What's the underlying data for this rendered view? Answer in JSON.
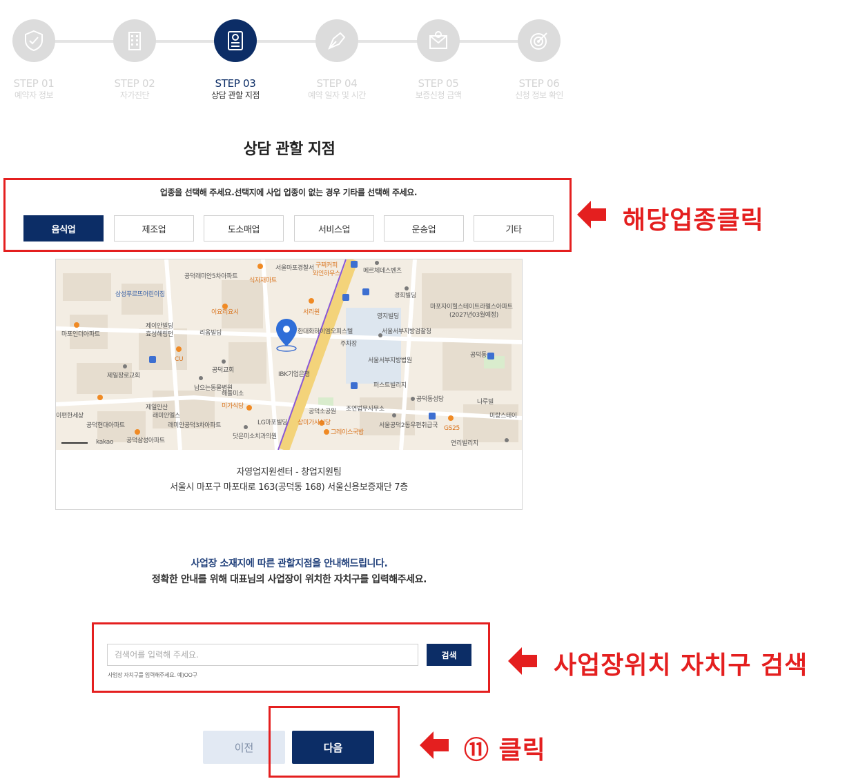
{
  "stepper": {
    "steps": [
      {
        "num": "STEP 01",
        "name": "예약자 정보",
        "icon": "shield-check-icon",
        "active": false
      },
      {
        "num": "STEP 02",
        "name": "자가진단",
        "icon": "building-icon",
        "active": false
      },
      {
        "num": "STEP 03",
        "name": "상담 관할 지점",
        "icon": "document-badge-icon",
        "active": true
      },
      {
        "num": "STEP 04",
        "name": "예약 일자 및 시간",
        "icon": "pen-nib-icon",
        "active": false
      },
      {
        "num": "STEP 05",
        "name": "보증신청 금액",
        "icon": "mail-icon",
        "active": false
      },
      {
        "num": "STEP 06",
        "name": "신청 정보 확인",
        "icon": "target-icon",
        "active": false
      }
    ]
  },
  "page_title": "상담 관할 지점",
  "industry": {
    "guide": "업종을 선택해 주세요.선택지에 사업 업종이 없는 경우 기타를 선택해 주세요.",
    "options": [
      "음식업",
      "제조업",
      "도소매업",
      "서비스업",
      "운송업",
      "기타"
    ],
    "selected": "음식업"
  },
  "map": {
    "labels": [
      "서울마포경찰서",
      "구찌커피",
      "와인하우스",
      "메르체데스벤츠",
      "공덕래미안5차아파트",
      "식자재마트",
      "경희빌딩",
      "이요리요시",
      "서리원",
      "영지빌딩",
      "마포자이힐스테이트라첼스아파트",
      "(2027년03월예정)",
      "삼성푸르뜨어린이집",
      "제이안빌딩",
      "효성해링턴",
      "한대화하이엠오피스텔",
      "서울서부지방검찰청",
      "마포인더아파트",
      "리움빌딩",
      "주차장",
      "공덕동",
      "CU",
      "제일장로교회",
      "공덕교회",
      "서울서부지방법원",
      "IBK기업은행",
      "퍼스트빌리지",
      "제일안산",
      "남으는동물병원",
      "해들미소",
      "공덕동성당",
      "나루빌",
      "미가식당",
      "래미안엘스",
      "조연법무사무소",
      "미랑스테이",
      "공덕현대아파트",
      "래미안공덕3차아파트",
      "LG마포빌딩",
      "상미가사식당",
      "공덕소공원",
      "서울공덕2동우편취급국",
      "GS25",
      "이편한세상",
      "공덕삼성아파트",
      "닷은미소치과의원",
      "그레이스국밥",
      "연리빌리지",
      "kakao"
    ],
    "address_line1": "자영업지원센터 - 창업지원팀",
    "address_line2": "서울시 마포구 마포대로 163(공덕동 168) 서울신용보증재단 7층",
    "marker_icon": "location-pin-icon"
  },
  "info": {
    "line1": "사업장 소재지에 따른 관할지점을 안내해드립니다.",
    "line2": "정확한 안내를 위해 대표님의 사업장이 위치한 자치구를 입력해주세요."
  },
  "search": {
    "placeholder": "검색어를 입력해 주세요.",
    "value": "",
    "button": "검색",
    "hint": "사업장 자치구를 입력해주세요. 예)OO구"
  },
  "nav": {
    "prev": "이전",
    "next": "다음"
  },
  "annotations": {
    "industry": "해당업종클릭",
    "search": "사업장위치 자치구 검색",
    "next": "⑪ 클릭"
  },
  "colors": {
    "primary": "#0c2d66",
    "annotation_red": "#e41f1f",
    "inactive_step": "#dcdcdc",
    "prev_button_bg": "#e2e9f3"
  }
}
